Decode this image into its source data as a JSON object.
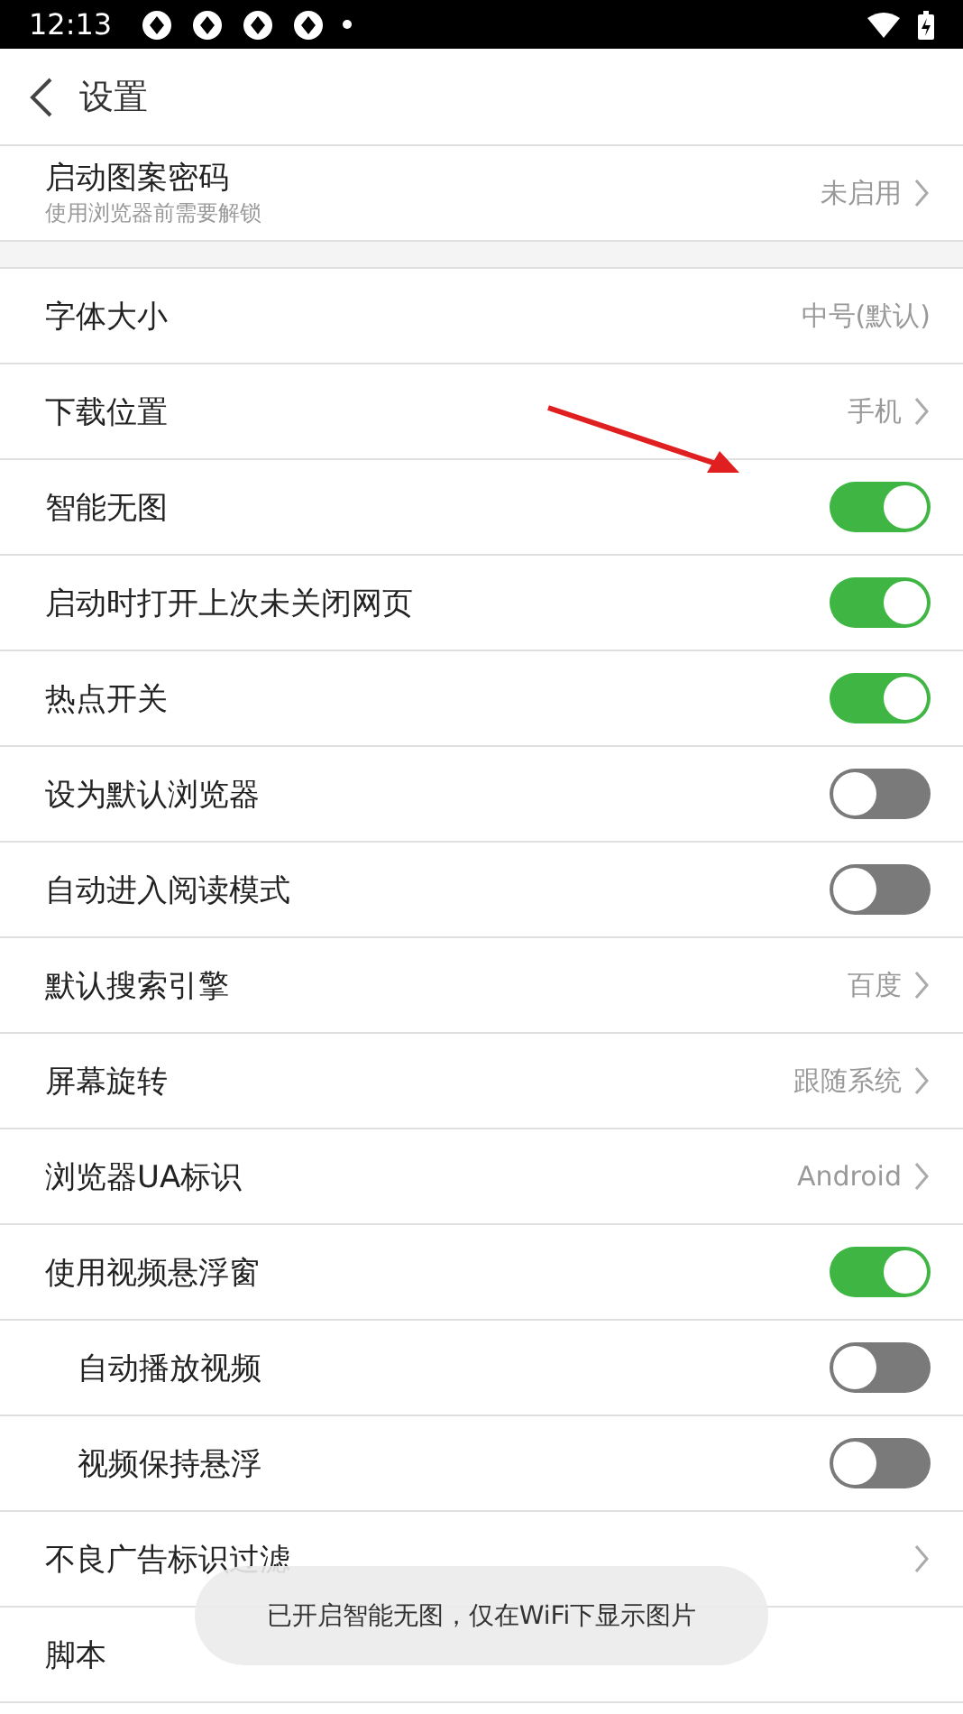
{
  "status_bar": {
    "time": "12:13"
  },
  "header": {
    "title": "设置"
  },
  "top_item": {
    "label": "启动图案密码",
    "subtitle": "使用浏览器前需要解锁",
    "value": "未启用",
    "chevron": true
  },
  "items": [
    {
      "kind": "value",
      "label": "字体大小",
      "value": "中号(默认)",
      "chevron": false,
      "indented": false
    },
    {
      "kind": "value",
      "label": "下载位置",
      "value": "手机",
      "chevron": true,
      "indented": false
    },
    {
      "kind": "toggle",
      "label": "智能无图",
      "on": true,
      "indented": false
    },
    {
      "kind": "toggle",
      "label": "启动时打开上次未关闭网页",
      "on": true,
      "indented": false
    },
    {
      "kind": "toggle",
      "label": "热点开关",
      "on": true,
      "indented": false
    },
    {
      "kind": "toggle",
      "label": "设为默认浏览器",
      "on": false,
      "indented": false
    },
    {
      "kind": "toggle",
      "label": "自动进入阅读模式",
      "on": false,
      "indented": false
    },
    {
      "kind": "value",
      "label": "默认搜索引擎",
      "value": "百度",
      "chevron": true,
      "indented": false
    },
    {
      "kind": "value",
      "label": "屏幕旋转",
      "value": "跟随系统",
      "chevron": true,
      "indented": false
    },
    {
      "kind": "value",
      "label": "浏览器UA标识",
      "value": "Android",
      "chevron": true,
      "indented": false
    },
    {
      "kind": "toggle",
      "label": "使用视频悬浮窗",
      "on": true,
      "indented": false
    },
    {
      "kind": "toggle",
      "label": "自动播放视频",
      "on": false,
      "indented": true
    },
    {
      "kind": "toggle",
      "label": "视频保持悬浮",
      "on": false,
      "indented": true
    },
    {
      "kind": "value",
      "label": "不良广告标识过滤",
      "chevron": true,
      "indented": false
    },
    {
      "kind": "value",
      "label": "脚本",
      "chevron": false,
      "indented": false
    }
  ],
  "toast": {
    "text": "已开启智能无图，仅在WiFi下显示图片"
  }
}
